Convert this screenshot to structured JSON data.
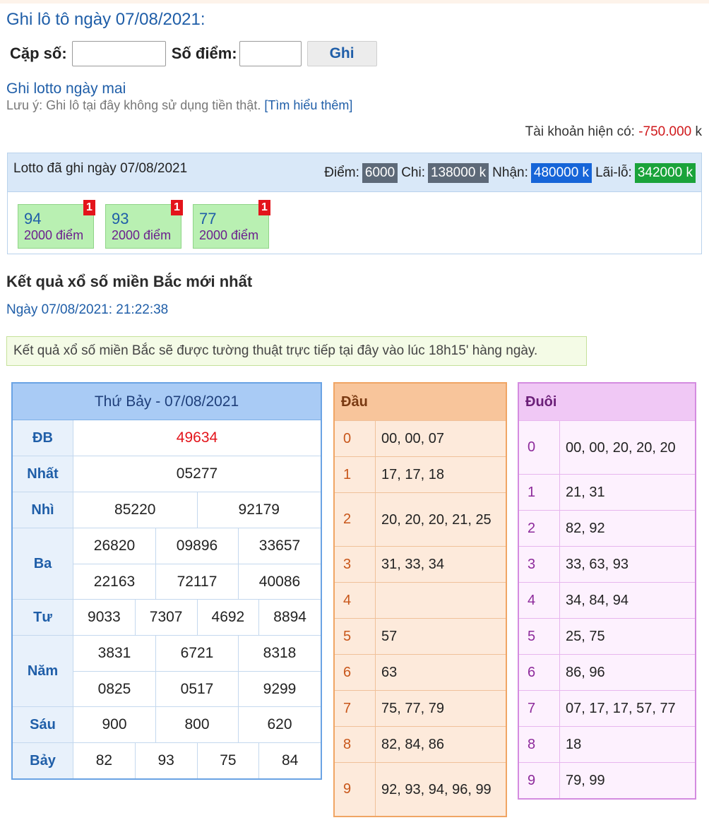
{
  "header": {
    "title": "Ghi lô tô ngày 07/08/2021:"
  },
  "form": {
    "pair_label": "Cặp số:",
    "points_label": "Số điểm:",
    "pair_value": "",
    "points_value": "",
    "submit_label": "Ghi"
  },
  "tomorrow_link": "Ghi lotto ngày mai",
  "note": {
    "text": "Lưu ý: Ghi lô tại đây không sử dụng tiền thật.",
    "link": "[Tìm hiểu thêm]"
  },
  "balance": {
    "label": "Tài khoản hiện có:",
    "value": "-750.000",
    "unit": "k"
  },
  "lotto": {
    "label": "Lotto đã ghi ngày 07/08/2021",
    "points_label": "Điểm:",
    "points_value": "6000",
    "spend_label": "Chi:",
    "spend_value": "138000 k",
    "receive_label": "Nhận:",
    "receive_value": "480000 k",
    "profit_label": "Lãi-lỗ:",
    "profit_value": "342000 k",
    "colors": {
      "points": "#5d6978",
      "receive": "#1665d8",
      "profit": "#1aa33a"
    },
    "tickets": [
      {
        "number": "94",
        "points": "2000 điểm",
        "badge": "1"
      },
      {
        "number": "93",
        "points": "2000 điểm",
        "badge": "1"
      },
      {
        "number": "77",
        "points": "2000 điểm",
        "badge": "1"
      }
    ]
  },
  "results": {
    "title": "Kết quả xổ số miền Bắc mới nhất",
    "date_line": "Ngày 07/08/2021: 21:22:38",
    "alert": "Kết quả xổ số miền Bắc sẽ được tường thuật trực tiếp tại đây vào lúc 18h15' hàng ngày.",
    "table_header": "Thứ Bảy - 07/08/2021",
    "prizes": [
      {
        "label": "ĐB",
        "rows": [
          [
            "49634"
          ]
        ],
        "highlight": true
      },
      {
        "label": "Nhất",
        "rows": [
          [
            "05277"
          ]
        ]
      },
      {
        "label": "Nhì",
        "rows": [
          [
            "85220",
            "92179"
          ]
        ]
      },
      {
        "label": "Ba",
        "rows": [
          [
            "26820",
            "09896",
            "33657"
          ],
          [
            "22163",
            "72117",
            "40086"
          ]
        ]
      },
      {
        "label": "Tư",
        "rows": [
          [
            "9033",
            "7307",
            "4692",
            "8894"
          ]
        ]
      },
      {
        "label": "Năm",
        "rows": [
          [
            "3831",
            "6721",
            "8318"
          ],
          [
            "0825",
            "0517",
            "9299"
          ]
        ]
      },
      {
        "label": "Sáu",
        "rows": [
          [
            "900",
            "800",
            "620"
          ]
        ]
      },
      {
        "label": "Bảy",
        "rows": [
          [
            "82",
            "93",
            "75",
            "84"
          ]
        ]
      }
    ]
  },
  "dau": {
    "header": "Đầu",
    "rows": [
      {
        "k": "0",
        "v": "00, 00, 07"
      },
      {
        "k": "1",
        "v": "17, 17, 18"
      },
      {
        "k": "2",
        "v": "20, 20, 20, 21, 25"
      },
      {
        "k": "3",
        "v": "31, 33, 34"
      },
      {
        "k": "4",
        "v": ""
      },
      {
        "k": "5",
        "v": "57"
      },
      {
        "k": "6",
        "v": "63"
      },
      {
        "k": "7",
        "v": "75, 77, 79"
      },
      {
        "k": "8",
        "v": "82, 84, 86"
      },
      {
        "k": "9",
        "v": "92, 93, 94, 96, 99"
      }
    ]
  },
  "duoi": {
    "header": "Đuôi",
    "rows": [
      {
        "k": "0",
        "v": "00, 00, 20, 20, 20"
      },
      {
        "k": "1",
        "v": "21, 31"
      },
      {
        "k": "2",
        "v": "82, 92"
      },
      {
        "k": "3",
        "v": "33, 63, 93"
      },
      {
        "k": "4",
        "v": "34, 84, 94"
      },
      {
        "k": "5",
        "v": "25, 75"
      },
      {
        "k": "6",
        "v": "86, 96"
      },
      {
        "k": "7",
        "v": "07, 17, 17, 57, 77"
      },
      {
        "k": "8",
        "v": "18"
      },
      {
        "k": "9",
        "v": "79, 99"
      }
    ]
  }
}
